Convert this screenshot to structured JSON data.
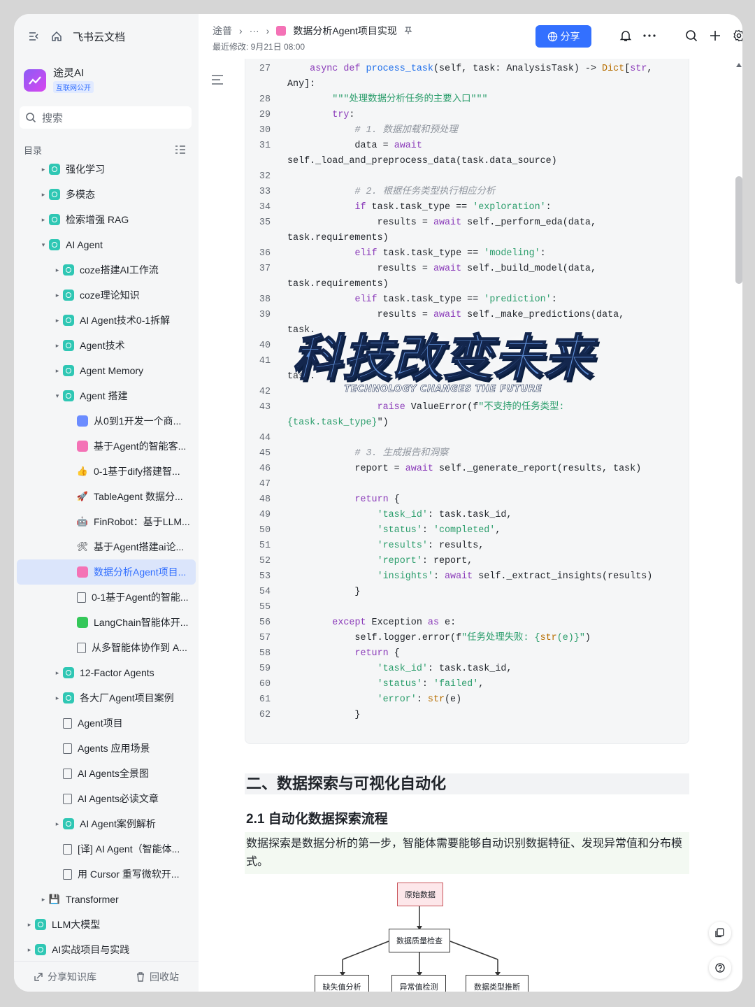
{
  "app": {
    "brand": "飞书云文档"
  },
  "space": {
    "name": "途灵AI",
    "badge": "互联网公开"
  },
  "search": {
    "placeholder": "搜索"
  },
  "toc": {
    "label": "目录"
  },
  "tree": [
    {
      "label": "强化学习",
      "level": 1,
      "arrow": "▸",
      "icon": "teal"
    },
    {
      "label": "多模态",
      "level": 1,
      "arrow": "▸",
      "icon": "teal"
    },
    {
      "label": "检索增强 RAG",
      "level": 1,
      "arrow": "▸",
      "icon": "teal"
    },
    {
      "label": "AI Agent",
      "level": 1,
      "arrow": "▾",
      "icon": "teal"
    },
    {
      "label": "coze搭建AI工作流",
      "level": 2,
      "arrow": "▸",
      "icon": "teal"
    },
    {
      "label": "coze理论知识",
      "level": 2,
      "arrow": "▸",
      "icon": "teal"
    },
    {
      "label": "AI Agent技术0-1拆解",
      "level": 2,
      "arrow": "▸",
      "icon": "teal"
    },
    {
      "label": "Agent技术",
      "level": 2,
      "arrow": "▸",
      "icon": "teal"
    },
    {
      "label": "Agent Memory",
      "level": 2,
      "arrow": "▸",
      "icon": "teal"
    },
    {
      "label": "Agent 搭建",
      "level": 2,
      "arrow": "▾",
      "icon": "teal"
    },
    {
      "label": "从0到1开发一个商...",
      "level": 3,
      "arrow": "",
      "icon": "blue"
    },
    {
      "label": "基于Agent的智能客...",
      "level": 3,
      "arrow": "",
      "icon": "pink"
    },
    {
      "label": "0-1基于dify搭建智...",
      "level": 3,
      "arrow": "",
      "icon": "emoji",
      "glyph": "👍"
    },
    {
      "label": "TableAgent 数据分...",
      "level": 3,
      "arrow": "",
      "icon": "emoji",
      "glyph": "🚀"
    },
    {
      "label": "FinRobot：基于LLM...",
      "level": 3,
      "arrow": "",
      "icon": "emoji",
      "glyph": "🤖"
    },
    {
      "label": "基于Agent搭建ai论...",
      "level": 3,
      "arrow": "",
      "icon": "emoji",
      "glyph": "🛠"
    },
    {
      "label": "数据分析Agent项目...",
      "level": 3,
      "arrow": "",
      "icon": "pink",
      "active": true
    },
    {
      "label": "0-1基于Agent的智能...",
      "level": 3,
      "arrow": "",
      "icon": "doc"
    },
    {
      "label": "LangChain智能体开...",
      "level": 3,
      "arrow": "",
      "icon": "green"
    },
    {
      "label": "从多智能体协作到 A...",
      "level": 3,
      "arrow": "",
      "icon": "doc"
    },
    {
      "label": "12-Factor Agents",
      "level": 2,
      "arrow": "▸",
      "icon": "teal"
    },
    {
      "label": "各大厂Agent项目案例",
      "level": 2,
      "arrow": "▸",
      "icon": "teal"
    },
    {
      "label": "Agent项目",
      "level": 2,
      "arrow": "",
      "icon": "doc"
    },
    {
      "label": "Agents 应用场景",
      "level": 2,
      "arrow": "",
      "icon": "doc"
    },
    {
      "label": "AI Agents全景图",
      "level": 2,
      "arrow": "",
      "icon": "doc"
    },
    {
      "label": "AI Agents必读文章",
      "level": 2,
      "arrow": "",
      "icon": "doc"
    },
    {
      "label": "AI Agent案例解析",
      "level": 2,
      "arrow": "▸",
      "icon": "teal"
    },
    {
      "label": "[译] AI Agent（智能体...",
      "level": 2,
      "arrow": "",
      "icon": "doc"
    },
    {
      "label": "用 Cursor 重写微软开...",
      "level": 2,
      "arrow": "",
      "icon": "doc"
    },
    {
      "label": "Transformer",
      "level": 1,
      "arrow": "▸",
      "icon": "emoji",
      "glyph": "💾"
    },
    {
      "label": "LLM大模型",
      "level": 0,
      "arrow": "▸",
      "icon": "teal"
    },
    {
      "label": "AI实战项目与实践",
      "level": 0,
      "arrow": "▸",
      "icon": "teal"
    }
  ],
  "sidebar_bottom": {
    "share": "分享知识库",
    "trash": "回收站"
  },
  "topbar": {
    "crumb_root": "途普",
    "crumb_more": "···",
    "doc_title": "数据分析Agent项目实现",
    "last_modified": "最近修改: 9月21日 08:00",
    "share_label": "分享"
  },
  "code_lines": [
    {
      "n": "27",
      "html": "    <span class='kw'>async def</span> <span class='fn'>process_task</span>(self, task: AnalysisTask) -> <span class='cls'>Dict</span>[<span class='kw'>str</span>,"
    },
    {
      "n": "",
      "html": "Any]:"
    },
    {
      "n": "28",
      "html": "        <span class='str'>\"\"\"处理数据分析任务的主要入口\"\"\"</span>"
    },
    {
      "n": "29",
      "html": "        <span class='kw'>try</span>:"
    },
    {
      "n": "30",
      "html": "            <span class='cmt'># 1. 数据加载和预处理</span>"
    },
    {
      "n": "31",
      "html": "            data = <span class='kw'>await</span>"
    },
    {
      "n": "",
      "html": "self._load_and_preprocess_data(task.data_source)"
    },
    {
      "n": "32",
      "html": ""
    },
    {
      "n": "33",
      "html": "            <span class='cmt'># 2. 根据任务类型执行相应分析</span>"
    },
    {
      "n": "34",
      "html": "            <span class='kw'>if</span> task.task_type == <span class='str'>'exploration'</span>:"
    },
    {
      "n": "35",
      "html": "                results = <span class='kw'>await</span> self._perform_eda(data,"
    },
    {
      "n": "",
      "html": "task.requirements)"
    },
    {
      "n": "36",
      "html": "            <span class='kw'>elif</span> task.task_type == <span class='str'>'modeling'</span>:"
    },
    {
      "n": "37",
      "html": "                results = <span class='kw'>await</span> self._build_model(data,"
    },
    {
      "n": "",
      "html": "task.requirements)"
    },
    {
      "n": "38",
      "html": "            <span class='kw'>elif</span> task.task_type == <span class='str'>'prediction'</span>:"
    },
    {
      "n": "39",
      "html": "                results = <span class='kw'>await</span> self._make_predictions(data,"
    },
    {
      "n": "",
      "html": "task."
    },
    {
      "n": "40",
      "html": ""
    },
    {
      "n": "41",
      "html": ""
    },
    {
      "n": "",
      "html": "task."
    },
    {
      "n": "42",
      "html": ""
    },
    {
      "n": "43",
      "html": "                <span class='kw'>raise</span> ValueError(f<span class='str'>\"不支持的任务类型:</span>"
    },
    {
      "n": "",
      "html": "<span class='str'>{task.task_type}</span>\")"
    },
    {
      "n": "44",
      "html": ""
    },
    {
      "n": "45",
      "html": "            <span class='cmt'># 3. 生成报告和洞察</span>"
    },
    {
      "n": "46",
      "html": "            report = <span class='kw'>await</span> self._generate_report(results, task)"
    },
    {
      "n": "47",
      "html": ""
    },
    {
      "n": "48",
      "html": "            <span class='kw'>return</span> {"
    },
    {
      "n": "49",
      "html": "                <span class='str'>'task_id'</span>: task.task_id,"
    },
    {
      "n": "50",
      "html": "                <span class='str'>'status'</span>: <span class='str'>'completed'</span>,"
    },
    {
      "n": "51",
      "html": "                <span class='str'>'results'</span>: results,"
    },
    {
      "n": "52",
      "html": "                <span class='str'>'report'</span>: report,"
    },
    {
      "n": "53",
      "html": "                <span class='str'>'insights'</span>: <span class='kw'>await</span> self._extract_insights(results)"
    },
    {
      "n": "54",
      "html": "            }"
    },
    {
      "n": "55",
      "html": ""
    },
    {
      "n": "56",
      "html": "        <span class='kw'>except</span> Exception <span class='kw'>as</span> e:"
    },
    {
      "n": "57",
      "html": "            self.logger.error(f<span class='str'>\"任务处理失败: {<span class='cls'>str</span>(e)}\"</span>)"
    },
    {
      "n": "58",
      "html": "            <span class='kw'>return</span> {"
    },
    {
      "n": "59",
      "html": "                <span class='str'>'task_id'</span>: task.task_id,"
    },
    {
      "n": "60",
      "html": "                <span class='str'>'status'</span>: <span class='str'>'failed'</span>,"
    },
    {
      "n": "61",
      "html": "                <span class='str'>'error'</span>: <span class='cls'>str</span>(e)"
    },
    {
      "n": "62",
      "html": "            }"
    }
  ],
  "watermark": {
    "big": "科技改变未来",
    "small": "TECHNOLOGY CHANGES THE FUTURE"
  },
  "section": {
    "h2": "二、数据探索与可视化自动化",
    "h3": "2.1 自动化数据探索流程",
    "para": "数据探索是数据分析的第一步，智能体需要能够自动识别数据特征、发现异常值和分布模式。"
  },
  "flow": {
    "root": "原始数据",
    "mid": "数据质量检查",
    "leaves": [
      "缺失值分析",
      "异常值检测",
      "数据类型推断"
    ]
  }
}
